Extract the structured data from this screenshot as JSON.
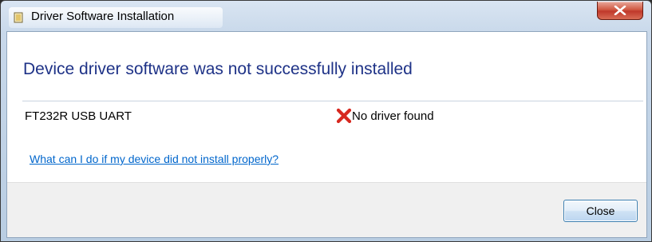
{
  "window": {
    "title": "Driver Software Installation",
    "close_icon": "close-x-icon",
    "app_icon": "driver-install-icon"
  },
  "main": {
    "heading": "Device driver software was not successfully installed",
    "device": {
      "name": "FT232R USB UART",
      "status_icon": "error-x-icon",
      "status_text": "No driver found"
    },
    "help_link": "What can I do if my device did not install properly?"
  },
  "footer": {
    "close_label": "Close"
  },
  "colors": {
    "heading": "#1e3287",
    "link": "#0066cc",
    "error": "#d7281f"
  }
}
